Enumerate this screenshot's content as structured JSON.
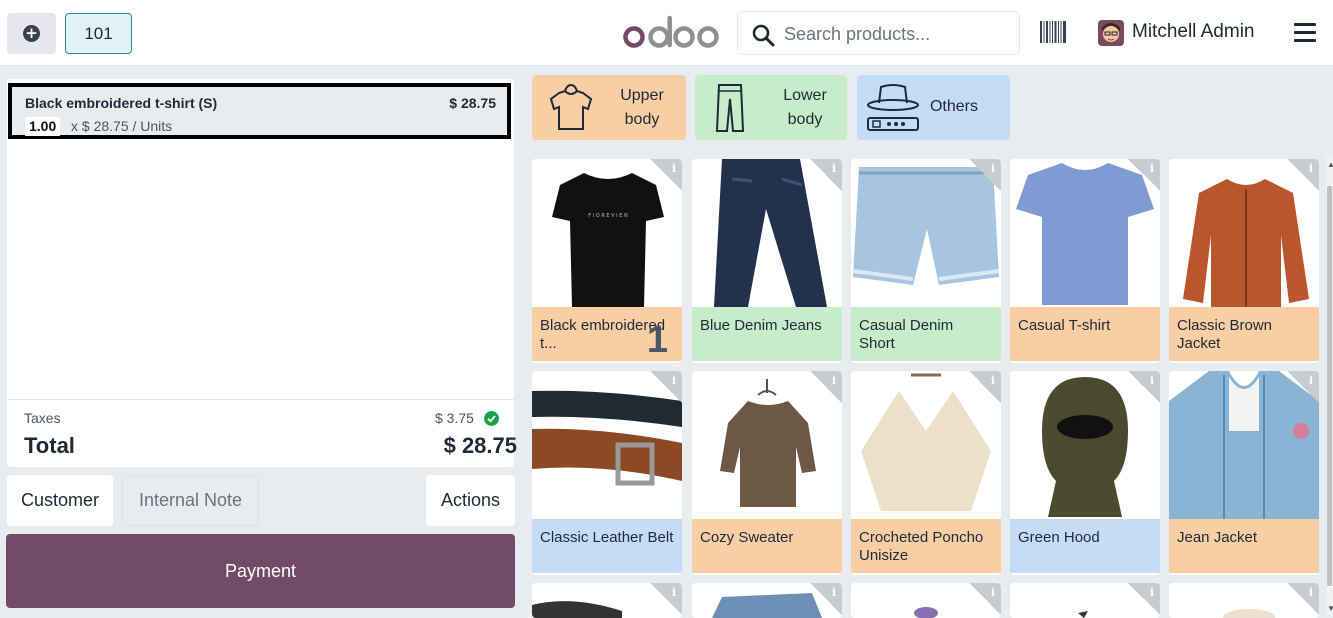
{
  "header": {
    "new_order_icon": "plus-circle-icon",
    "table_number": "101",
    "logo_text": "odoo",
    "search_placeholder": "Search products...",
    "user_name": "Mitchell Admin"
  },
  "order": {
    "lines": [
      {
        "name": "Black embroidered t-shirt (S)",
        "price": "$ 28.75",
        "qty": "1.00",
        "unit_text": "x $ 28.75 / Units"
      }
    ],
    "taxes_label": "Taxes",
    "taxes_value": "$ 3.75",
    "total_label": "Total",
    "total_value": "$ 28.75"
  },
  "buttons": {
    "customer": "Customer",
    "internal_note": "Internal Note",
    "actions": "Actions",
    "payment": "Payment"
  },
  "categories": [
    {
      "label_line1": "Upper",
      "label_line2": "body",
      "color": "#f8cfa5",
      "icon": "tshirt-icon"
    },
    {
      "label_line1": "Lower",
      "label_line2": "body",
      "color": "#c6ecc9",
      "icon": "pants-icon"
    },
    {
      "label_line1": "Others",
      "label_line2": "",
      "color": "#c5dcf6",
      "icon": "hat-belt-icon"
    }
  ],
  "products": [
    {
      "name": "Black embroidered t...",
      "cat": "peach",
      "qty": "1"
    },
    {
      "name": "Blue Denim Jeans",
      "cat": "green",
      "qty": ""
    },
    {
      "name": "Casual Denim Short",
      "cat": "green",
      "qty": ""
    },
    {
      "name": "Casual T-shirt",
      "cat": "peach",
      "qty": ""
    },
    {
      "name": "Classic Brown Jacket",
      "cat": "peach",
      "qty": ""
    },
    {
      "name": "Classic Leather Belt",
      "cat": "blue",
      "qty": ""
    },
    {
      "name": "Cozy Sweater",
      "cat": "peach",
      "qty": ""
    },
    {
      "name": "Crocheted Poncho Unisize",
      "cat": "peach",
      "qty": ""
    },
    {
      "name": "Green Hood",
      "cat": "blue",
      "qty": ""
    },
    {
      "name": "Jean Jacket",
      "cat": "peach",
      "qty": ""
    }
  ],
  "colors": {
    "brand": "#714b67",
    "accent_teal": "#2e8b96",
    "success": "#16a34a"
  }
}
